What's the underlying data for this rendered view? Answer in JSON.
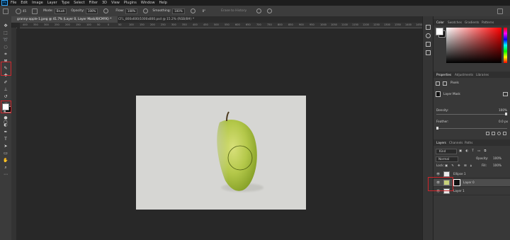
{
  "menu": {
    "logo": "Ps",
    "items": [
      "File",
      "Edit",
      "Image",
      "Layer",
      "Type",
      "Select",
      "Filter",
      "3D",
      "View",
      "Plugins",
      "Window",
      "Help"
    ]
  },
  "options": {
    "mode_label": "Mode:",
    "mode_value": "Brush",
    "opacity_label": "Opacity:",
    "opacity_value": "100%",
    "flow_label": "Flow:",
    "flow_value": "100%",
    "smoothing_label": "Smoothing:",
    "smoothing_value": "100%",
    "angle_value": "0°",
    "brush_size": "45",
    "erase_history_label": "Erase to History"
  },
  "tabs": [
    {
      "label": "granny-apple-1.jpeg @ 41.7% (Layer 0, Layer Mask/8/CMYK) *",
      "active": true
    },
    {
      "label": "CFL_800x600/1000x800.psd @ 15.2% (RGB/8#) *",
      "active": false
    }
  ],
  "ruler_ticks": [
    "400",
    "350",
    "300",
    "250",
    "200",
    "150",
    "100",
    "50",
    "0",
    "50",
    "100",
    "150",
    "200",
    "250",
    "300",
    "350",
    "400",
    "450",
    "500",
    "550",
    "600",
    "650",
    "700",
    "750",
    "800",
    "850",
    "900",
    "950",
    "1000",
    "1050",
    "1100",
    "1150",
    "1200",
    "1250",
    "1300",
    "1350",
    "1400",
    "1450",
    "1500"
  ],
  "color_panel": {
    "tabs": [
      "Color",
      "Swatches",
      "Gradients",
      "Patterns"
    ],
    "active_index": 0,
    "hue_color": "#ff0000"
  },
  "properties": {
    "tabs": [
      "Properties",
      "Adjustments",
      "Libraries"
    ],
    "section1": "Pixels",
    "section2": "Layer Mask",
    "density_label": "Density:",
    "density_value": "100%",
    "feather_label": "Feather:",
    "feather_value": "0.0 px",
    "density_fill": 1.0,
    "feather_fill": 0.0
  },
  "layers_panel": {
    "tabs": [
      "Layers",
      "Channels",
      "Paths"
    ],
    "kind_label": "Kind",
    "blend_mode": "Normal",
    "opacity_label": "Opacity:",
    "opacity_value": "100%",
    "lock_label": "Lock:",
    "fill_label": "Fill:",
    "fill_value": "100%",
    "layers": [
      {
        "name": "Ellipse 1",
        "selected": false
      },
      {
        "name": "Layer 0",
        "selected": true
      },
      {
        "name": "Layer 1",
        "selected": false
      }
    ]
  },
  "colors": {
    "menubar": "#1d1d1d",
    "panel": "#383838",
    "highlight_red": "#d0262c",
    "doc_bg": "#d6d6d3",
    "apple_green": "#b4c84a"
  }
}
